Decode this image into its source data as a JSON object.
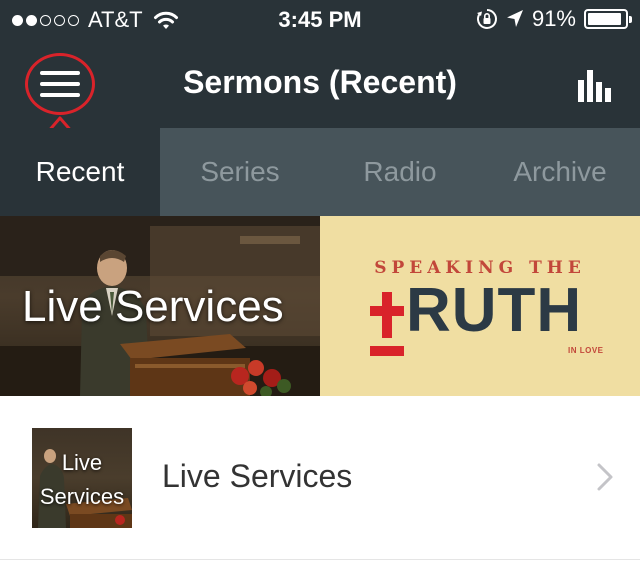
{
  "status_bar": {
    "carrier": "AT&T",
    "time": "3:45 PM",
    "battery_percent": "91%",
    "battery_level": 0.91,
    "signal_bars_filled": 2,
    "signal_bars_total": 5,
    "icons": [
      "wifi-icon",
      "orientation-lock-icon",
      "location-icon",
      "battery-icon"
    ]
  },
  "nav": {
    "title": "Sermons (Recent)",
    "menu_icon": "hamburger-menu-icon",
    "stats_icon": "bar-chart-icon",
    "annotation_color": "#d9232a"
  },
  "tabs": [
    {
      "label": "Recent",
      "active": true
    },
    {
      "label": "Series",
      "active": false
    },
    {
      "label": "Radio",
      "active": false
    },
    {
      "label": "Archive",
      "active": false
    }
  ],
  "banners": {
    "live": {
      "text": "Live Services"
    },
    "truth": {
      "top_line": "SPEAKING THE",
      "main_word": "RUTH",
      "sub_line": "IN LOVE"
    }
  },
  "list": {
    "items": [
      {
        "thumb_line1": "Live",
        "thumb_line2": "Services",
        "label": "Live Services"
      }
    ]
  },
  "colors": {
    "chrome_bg": "#293338",
    "tab_bar_bg": "#47545a",
    "truth_bg": "#f0dea2",
    "truth_red": "#c2473a",
    "truth_navy": "#2c3a45"
  }
}
